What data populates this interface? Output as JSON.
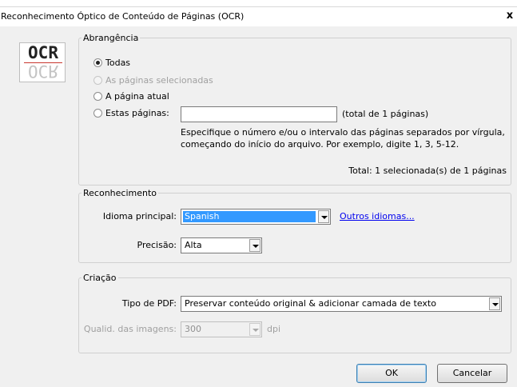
{
  "window": {
    "title": "Reconhecimento Óptico de Conteúdo de Páginas (OCR)",
    "close": "x"
  },
  "logo": {
    "text": "OCR"
  },
  "scope": {
    "legend": "Abrangência",
    "options": [
      {
        "label": "Todas",
        "checked": true,
        "enabled": true
      },
      {
        "label": "As páginas selecionadas",
        "checked": false,
        "enabled": false
      },
      {
        "label": "A página atual",
        "checked": false,
        "enabled": true
      },
      {
        "label": "Estas páginas:",
        "checked": false,
        "enabled": true
      }
    ],
    "pages_value": "",
    "pages_total": "(total de 1 páginas)",
    "hint_line1": "Especifique o número e/ou o intervalo das páginas separados por vírgula,",
    "hint_line2": "começando do início do arquivo. Por exemplo, digite 1, 3, 5-12.",
    "summary": "Total: 1 selecionada(s) de 1 páginas"
  },
  "recognition": {
    "legend": "Reconhecimento",
    "language_label": "Idioma principal:",
    "language_value": "Spanish",
    "other_languages": "Outros idiomas...",
    "precision_label": "Precisão:",
    "precision_value": "Alta"
  },
  "creation": {
    "legend": "Criação",
    "pdf_type_label": "Tipo de PDF:",
    "pdf_type_value": "Preservar conteúdo original & adicionar camada de texto",
    "image_quality_label": "Qualid. das imagens:",
    "image_quality_value": "300",
    "image_quality_unit": "dpi"
  },
  "buttons": {
    "ok": "OK",
    "cancel": "Cancelar"
  }
}
